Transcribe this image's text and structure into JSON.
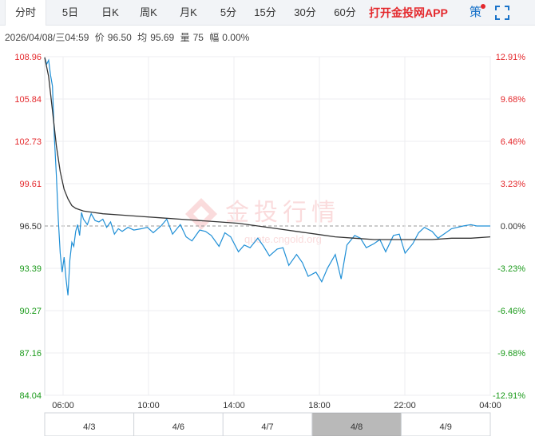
{
  "tabs": [
    {
      "label": "分时",
      "active": true
    },
    {
      "label": "5日",
      "active": false
    },
    {
      "label": "日K",
      "active": false
    },
    {
      "label": "周K",
      "active": false
    },
    {
      "label": "月K",
      "active": false
    },
    {
      "label": "5分",
      "active": false
    },
    {
      "label": "15分",
      "active": false
    },
    {
      "label": "30分",
      "active": false
    },
    {
      "label": "60分",
      "active": false
    }
  ],
  "promo_label": "打开金投网APP",
  "strategy_label": "策",
  "info": {
    "datetime": "2026/04/08/三04:59",
    "price_label": "价",
    "price": "96.50",
    "avg_label": "均",
    "avg": "95.69",
    "vol_label": "量",
    "vol": "75",
    "amp_label": "幅",
    "amp": "0.00%"
  },
  "watermark": {
    "text": "金投行情",
    "url": "quote.cngold.org"
  },
  "colors": {
    "price_line": "#1f8fd6",
    "avg_line": "#333333",
    "up": "#e4282c",
    "down": "#1a9a1a",
    "flat": "#333333"
  },
  "chart_data": {
    "type": "line",
    "reference_price": 96.5,
    "ylim": [
      84.04,
      108.96
    ],
    "y_ticks_left": [
      "108.96",
      "105.84",
      "102.73",
      "99.61",
      "96.50",
      "93.39",
      "90.27",
      "87.16",
      "84.04"
    ],
    "y_ticks_right": [
      "12.91%",
      "9.68%",
      "6.46%",
      "3.23%",
      "0.00%",
      "-3.23%",
      "-6.46%",
      "-9.68%",
      "-12.91%"
    ],
    "x_ticks": [
      "06:00",
      "10:00",
      "14:00",
      "18:00",
      "22:00",
      "04:00"
    ],
    "x_range_hours": [
      0,
      23
    ],
    "series": [
      {
        "key": "price",
        "x": [
          0,
          0.1,
          0.2,
          0.3,
          0.4,
          0.5,
          0.6,
          0.7,
          0.8,
          0.9,
          1.0,
          1.1,
          1.2,
          1.3,
          1.4,
          1.5,
          1.6,
          1.7,
          1.8,
          1.9,
          2.0,
          2.2,
          2.4,
          2.6,
          2.8,
          3.0,
          3.2,
          3.4,
          3.6,
          3.8,
          4.0,
          4.3,
          4.6,
          5.0,
          5.3,
          5.6,
          6.0,
          6.3,
          6.6,
          7.0,
          7.3,
          7.6,
          8.0,
          8.3,
          8.6,
          9.0,
          9.3,
          9.6,
          10.0,
          10.3,
          10.6,
          11.0,
          11.3,
          11.6,
          12.0,
          12.3,
          12.6,
          13.0,
          13.3,
          13.6,
          14.0,
          14.3,
          14.6,
          15.0,
          15.3,
          15.6,
          16.0,
          16.3,
          16.6,
          17.0,
          17.3,
          17.6,
          18.0,
          18.3,
          18.6,
          19.0,
          19.3,
          19.6,
          20.0,
          20.3,
          20.6,
          21.0,
          21.3,
          21.6,
          22.0,
          22.3,
          22.6,
          22.9,
          23.0
        ],
        "y": [
          108.9,
          108.4,
          108.7,
          107.6,
          106.8,
          103.0,
          100.2,
          97.0,
          94.5,
          93.1,
          94.2,
          92.6,
          91.4,
          94.0,
          95.3,
          95.0,
          96.1,
          96.6,
          95.8,
          97.5,
          97.0,
          96.6,
          97.4,
          96.9,
          96.8,
          97.0,
          96.4,
          96.8,
          95.9,
          96.3,
          96.1,
          96.4,
          96.2,
          96.3,
          96.4,
          96.0,
          96.5,
          97.0,
          95.9,
          96.6,
          95.7,
          95.4,
          96.2,
          96.1,
          95.8,
          95.0,
          96.0,
          95.7,
          94.6,
          95.1,
          94.9,
          95.6,
          95.0,
          94.3,
          94.8,
          94.9,
          93.6,
          94.4,
          93.8,
          92.8,
          93.1,
          92.4,
          93.4,
          94.4,
          92.6,
          95.1,
          95.8,
          95.6,
          94.9,
          95.2,
          95.5,
          94.6,
          95.8,
          95.9,
          94.5,
          95.2,
          96.0,
          96.4,
          96.1,
          95.6,
          95.9,
          96.3,
          96.4,
          96.5,
          96.6,
          96.5,
          96.5,
          96.5,
          96.5
        ]
      },
      {
        "key": "avg",
        "x": [
          0,
          0.2,
          0.4,
          0.6,
          0.8,
          1.0,
          1.2,
          1.4,
          1.6,
          1.8,
          2.0,
          2.5,
          3.0,
          4.0,
          5.0,
          6.0,
          7.0,
          8.0,
          9.0,
          10.0,
          11.0,
          12.0,
          13.0,
          14.0,
          15.0,
          16.0,
          17.0,
          18.0,
          19.0,
          20.0,
          21.0,
          22.0,
          23.0
        ],
        "y": [
          108.9,
          107.5,
          105.0,
          102.4,
          100.5,
          99.2,
          98.5,
          98.0,
          97.8,
          97.7,
          97.6,
          97.5,
          97.4,
          97.3,
          97.2,
          97.1,
          97.0,
          96.9,
          96.8,
          96.7,
          96.5,
          96.3,
          96.1,
          95.9,
          95.7,
          95.6,
          95.5,
          95.5,
          95.5,
          95.5,
          95.6,
          95.6,
          95.7
        ]
      }
    ]
  },
  "navigator": {
    "days": [
      "4/3",
      "4/6",
      "4/7",
      "4/8",
      "4/9"
    ],
    "selected_index": 3
  }
}
